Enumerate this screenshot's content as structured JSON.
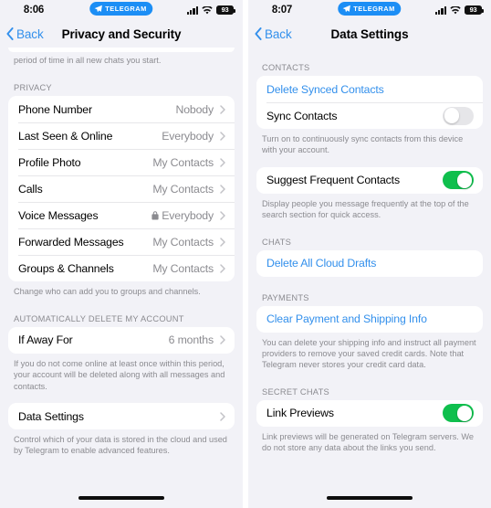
{
  "left": {
    "status": {
      "time": "8:06",
      "badge_label": "TELEGRAM",
      "battery": "93",
      "badge_color": "#1c8ef5"
    },
    "nav": {
      "back_label": "Back",
      "title": "Privacy and Security"
    },
    "clipped_note": "period of time in all new chats you start.",
    "privacy": {
      "header": "PRIVACY",
      "rows": [
        {
          "label": "Phone Number",
          "value": "Nobody",
          "lock": false
        },
        {
          "label": "Last Seen & Online",
          "value": "Everybody",
          "lock": false
        },
        {
          "label": "Profile Photo",
          "value": "My Contacts",
          "lock": false
        },
        {
          "label": "Calls",
          "value": "My Contacts",
          "lock": false
        },
        {
          "label": "Voice Messages",
          "value": "Everybody",
          "lock": true
        },
        {
          "label": "Forwarded Messages",
          "value": "My Contacts",
          "lock": false
        },
        {
          "label": "Groups & Channels",
          "value": "My Contacts",
          "lock": false
        }
      ],
      "footer": "Change who can add you to groups and channels."
    },
    "auto_delete": {
      "header": "AUTOMATICALLY DELETE MY ACCOUNT",
      "row": {
        "label": "If Away For",
        "value": "6 months"
      },
      "footer": "If you do not come online at least once within this period, your account will be deleted along with all messages and contacts."
    },
    "data": {
      "row": {
        "label": "Data Settings"
      },
      "footer": "Control which of your data is stored in the cloud and used by Telegram to enable advanced features."
    }
  },
  "right": {
    "status": {
      "time": "8:07",
      "badge_label": "TELEGRAM",
      "battery": "93",
      "badge_color": "#1c8ef5"
    },
    "nav": {
      "back_label": "Back",
      "title": "Data Settings"
    },
    "contacts": {
      "header": "CONTACTS",
      "delete_synced_label": "Delete Synced Contacts",
      "sync_label": "Sync Contacts",
      "sync_on": false,
      "footer": "Turn on to continuously sync contacts from this device with your account."
    },
    "suggest": {
      "label": "Suggest Frequent Contacts",
      "on": true,
      "footer": "Display people you message frequently at the top of the search section for quick access."
    },
    "chats": {
      "header": "CHATS",
      "delete_drafts_label": "Delete All Cloud Drafts"
    },
    "payments": {
      "header": "PAYMENTS",
      "clear_label": "Clear Payment and Shipping Info",
      "footer": "You can delete your shipping info and instruct all payment providers to remove your saved credit cards. Note that Telegram never stores your credit card data."
    },
    "secret": {
      "header": "SECRET CHATS",
      "link_previews_label": "Link Previews",
      "on": true,
      "footer": "Link previews will be generated on Telegram servers. We do not store any data about the links you send."
    }
  },
  "theme": {
    "accent": "#3390ec",
    "toggle_on": "#0fbf4d",
    "page_bg": "#f2f2f7",
    "card_bg": "#ffffff",
    "secondary_text": "#8b8b90"
  }
}
